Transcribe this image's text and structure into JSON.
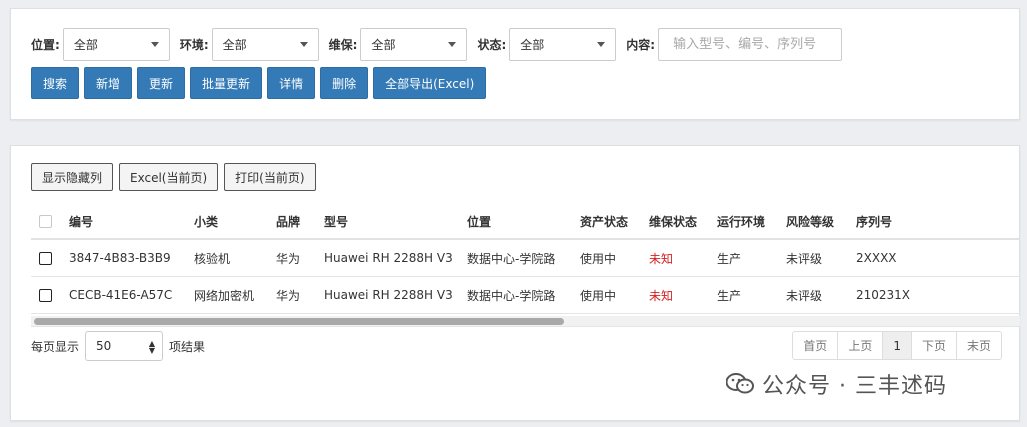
{
  "filters": {
    "location": {
      "label": "位置:",
      "value": "全部"
    },
    "environment": {
      "label": "环境:",
      "value": "全部"
    },
    "maintenance": {
      "label": "维保:",
      "value": "全部"
    },
    "status": {
      "label": "状态:",
      "value": "全部"
    },
    "content": {
      "label": "内容:",
      "placeholder": "输入型号、编号、序列号"
    }
  },
  "actions": {
    "search": "搜索",
    "add": "新增",
    "update": "更新",
    "batch_update": "批量更新",
    "detail": "详情",
    "delete": "删除",
    "export_all": "全部导出(Excel)"
  },
  "toolbar": {
    "show_hidden_columns": "显示隐藏列",
    "excel_current_page": "Excel(当前页)",
    "print_current_page": "打印(当前页)"
  },
  "table": {
    "columns": [
      "编号",
      "小类",
      "品牌",
      "型号",
      "位置",
      "资产状态",
      "维保状态",
      "运行环境",
      "风险等级",
      "序列号"
    ],
    "rows": [
      [
        "3847-4B83-B3B9",
        "核验机",
        "华为",
        "Huawei RH 2288H V3",
        "数据中心-学院路",
        "使用中",
        "未知",
        "生产",
        "未评级",
        "2XXXX"
      ],
      [
        "CECB-41E6-A57C",
        "网络加密机",
        "华为",
        "Huawei RH 2288H V3",
        "数据中心-学院路",
        "使用中",
        "未知",
        "生产",
        "未评级",
        "210231X"
      ]
    ]
  },
  "pagination": {
    "page_size_label": "每页显示",
    "page_size": "50",
    "results_label": "项结果",
    "first": "首页",
    "prev": "上页",
    "current": "1",
    "next": "下页",
    "last": "末页"
  },
  "watermark": {
    "text": "公众号 · 三丰述码",
    "icon": "wechat-icon"
  },
  "colors": {
    "primary": "#337ab7",
    "danger": "#d61f1f",
    "background": "#eceef1"
  }
}
